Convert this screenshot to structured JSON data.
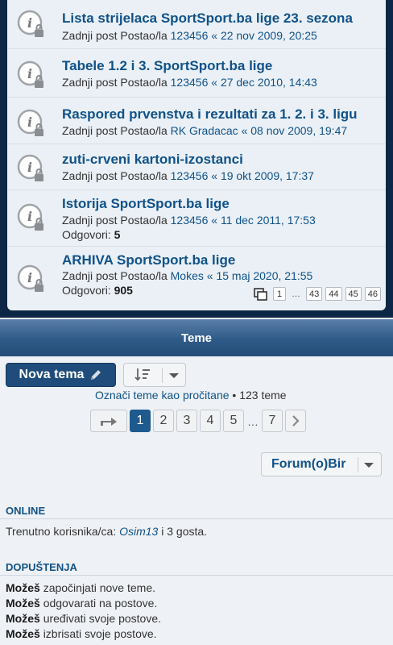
{
  "topics": [
    {
      "title": "Lista strijelaca SportSport.ba lige 23. sezona",
      "meta_prefix": "Zadnji post Postao/la",
      "author": "123456",
      "sep": "«",
      "date": "22 nov 2009, 20:25"
    },
    {
      "title": "Tabele 1.2 i 3. SportSport.ba lige",
      "meta_prefix": "Zadnji post Postao/la",
      "author": "123456",
      "sep": "«",
      "date": "27 dec 2010, 14:43"
    },
    {
      "title": "Raspored prvenstva i rezultati za 1. 2. i 3. ligu",
      "meta_prefix": "Zadnji post Postao/la",
      "author": "RK Gradacac",
      "sep": "«",
      "date": "08 nov 2009, 19:47"
    },
    {
      "title": "zuti-crveni kartoni-izostanci",
      "meta_prefix": "Zadnji post Postao/la",
      "author": "123456",
      "sep": "«",
      "date": "19 okt 2009, 17:37"
    },
    {
      "title": "Istorija SportSport.ba lige",
      "meta_prefix": "Zadnji post Postao/la",
      "author": "123456",
      "sep": "«",
      "date": "11 dec 2011, 17:53",
      "replies_label": "Odgovori:",
      "replies": "5"
    },
    {
      "title": "ARHIVA SportSport.ba lige",
      "meta_prefix": "Zadnji post Postao/la",
      "author": "Mokes",
      "sep": "«",
      "date": "15 maj 2020, 21:55",
      "replies_label": "Odgovori:",
      "replies": "905",
      "pages": [
        "1",
        "…",
        "43",
        "44",
        "45",
        "46"
      ]
    }
  ],
  "section_title": "Teme",
  "toolbar": {
    "new_topic": "Nova tema"
  },
  "mark_read": {
    "link": "Označi teme kao pročitane",
    "count": "• 123 teme"
  },
  "pagination": {
    "pages": [
      "1",
      "2",
      "3",
      "4",
      "5"
    ],
    "dots": "…",
    "last": "7",
    "current": "1"
  },
  "forum_jump": {
    "label": "Forum(o)Bir"
  },
  "online": {
    "heading": "ONLINE",
    "prefix": "Trenutno korisnika/ca:",
    "user": "Osim13",
    "suffix": "i 3 gosta."
  },
  "permissions": {
    "heading": "DOPUŠTENJA",
    "items": [
      {
        "bold": "Možeš",
        "text": "započinjati nove teme."
      },
      {
        "bold": "Možeš",
        "text": "odgovarati na postove."
      },
      {
        "bold": "Možeš",
        "text": "uređivati svoje postove."
      },
      {
        "bold": "Možeš",
        "text": "izbrisati svoje postove."
      }
    ]
  },
  "colors": {
    "link": "#105289",
    "nav": "#0f2746",
    "primary_button": "#1f4c7b",
    "active_page": "#1f5a8f"
  }
}
